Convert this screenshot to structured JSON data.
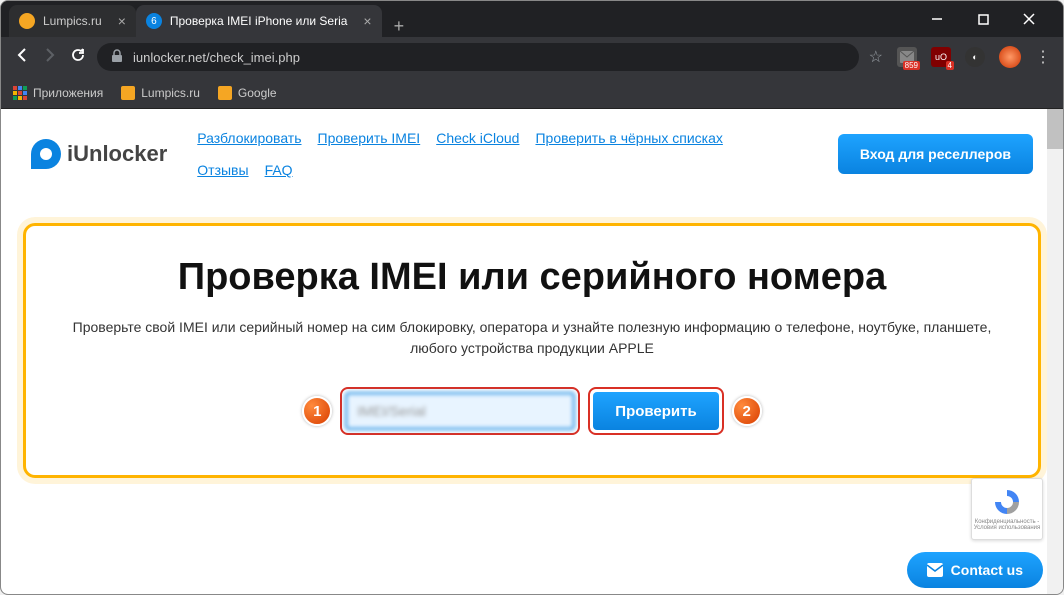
{
  "browser": {
    "tabs": [
      {
        "title": "Lumpics.ru",
        "favicon_color": "#f5a623"
      },
      {
        "title": "Проверка IMEI iPhone или Seria",
        "favicon_color": "#0a83e0",
        "favicon_text": "6"
      }
    ],
    "url_display": "iunlocker.net/check_imei.php",
    "bookmarks": {
      "apps_label": "Приложения",
      "items": [
        {
          "label": "Lumpics.ru",
          "color": "#f5a623"
        },
        {
          "label": "Google",
          "color": "#f5a623"
        }
      ]
    },
    "extensions": {
      "inbox_count": "859",
      "ublock_count": "4"
    }
  },
  "site": {
    "logo_text": "iUnlocker",
    "nav": [
      "Разблокировать",
      "Проверить IMEI",
      "Check iCloud",
      "Проверить в чёрных списках",
      "Отзывы",
      "FAQ"
    ],
    "cta": "Вход для реселлеров",
    "hero": {
      "title": "Проверка IMEI или серийного номера",
      "subtitle": "Проверьте свой IMEI или серийный номер на сим блокировку, оператора и узнайте полезную информацию о телефоне, ноутбуке, планшете, любого устройства продукции APPLE",
      "input_value": "IMEI/Serial",
      "check_button": "Проверить",
      "marker_1": "1",
      "marker_2": "2"
    },
    "recaptcha": {
      "line1": "Конфиденциальность -",
      "line2": "Условия использования"
    },
    "contact_us": "Contact us"
  }
}
